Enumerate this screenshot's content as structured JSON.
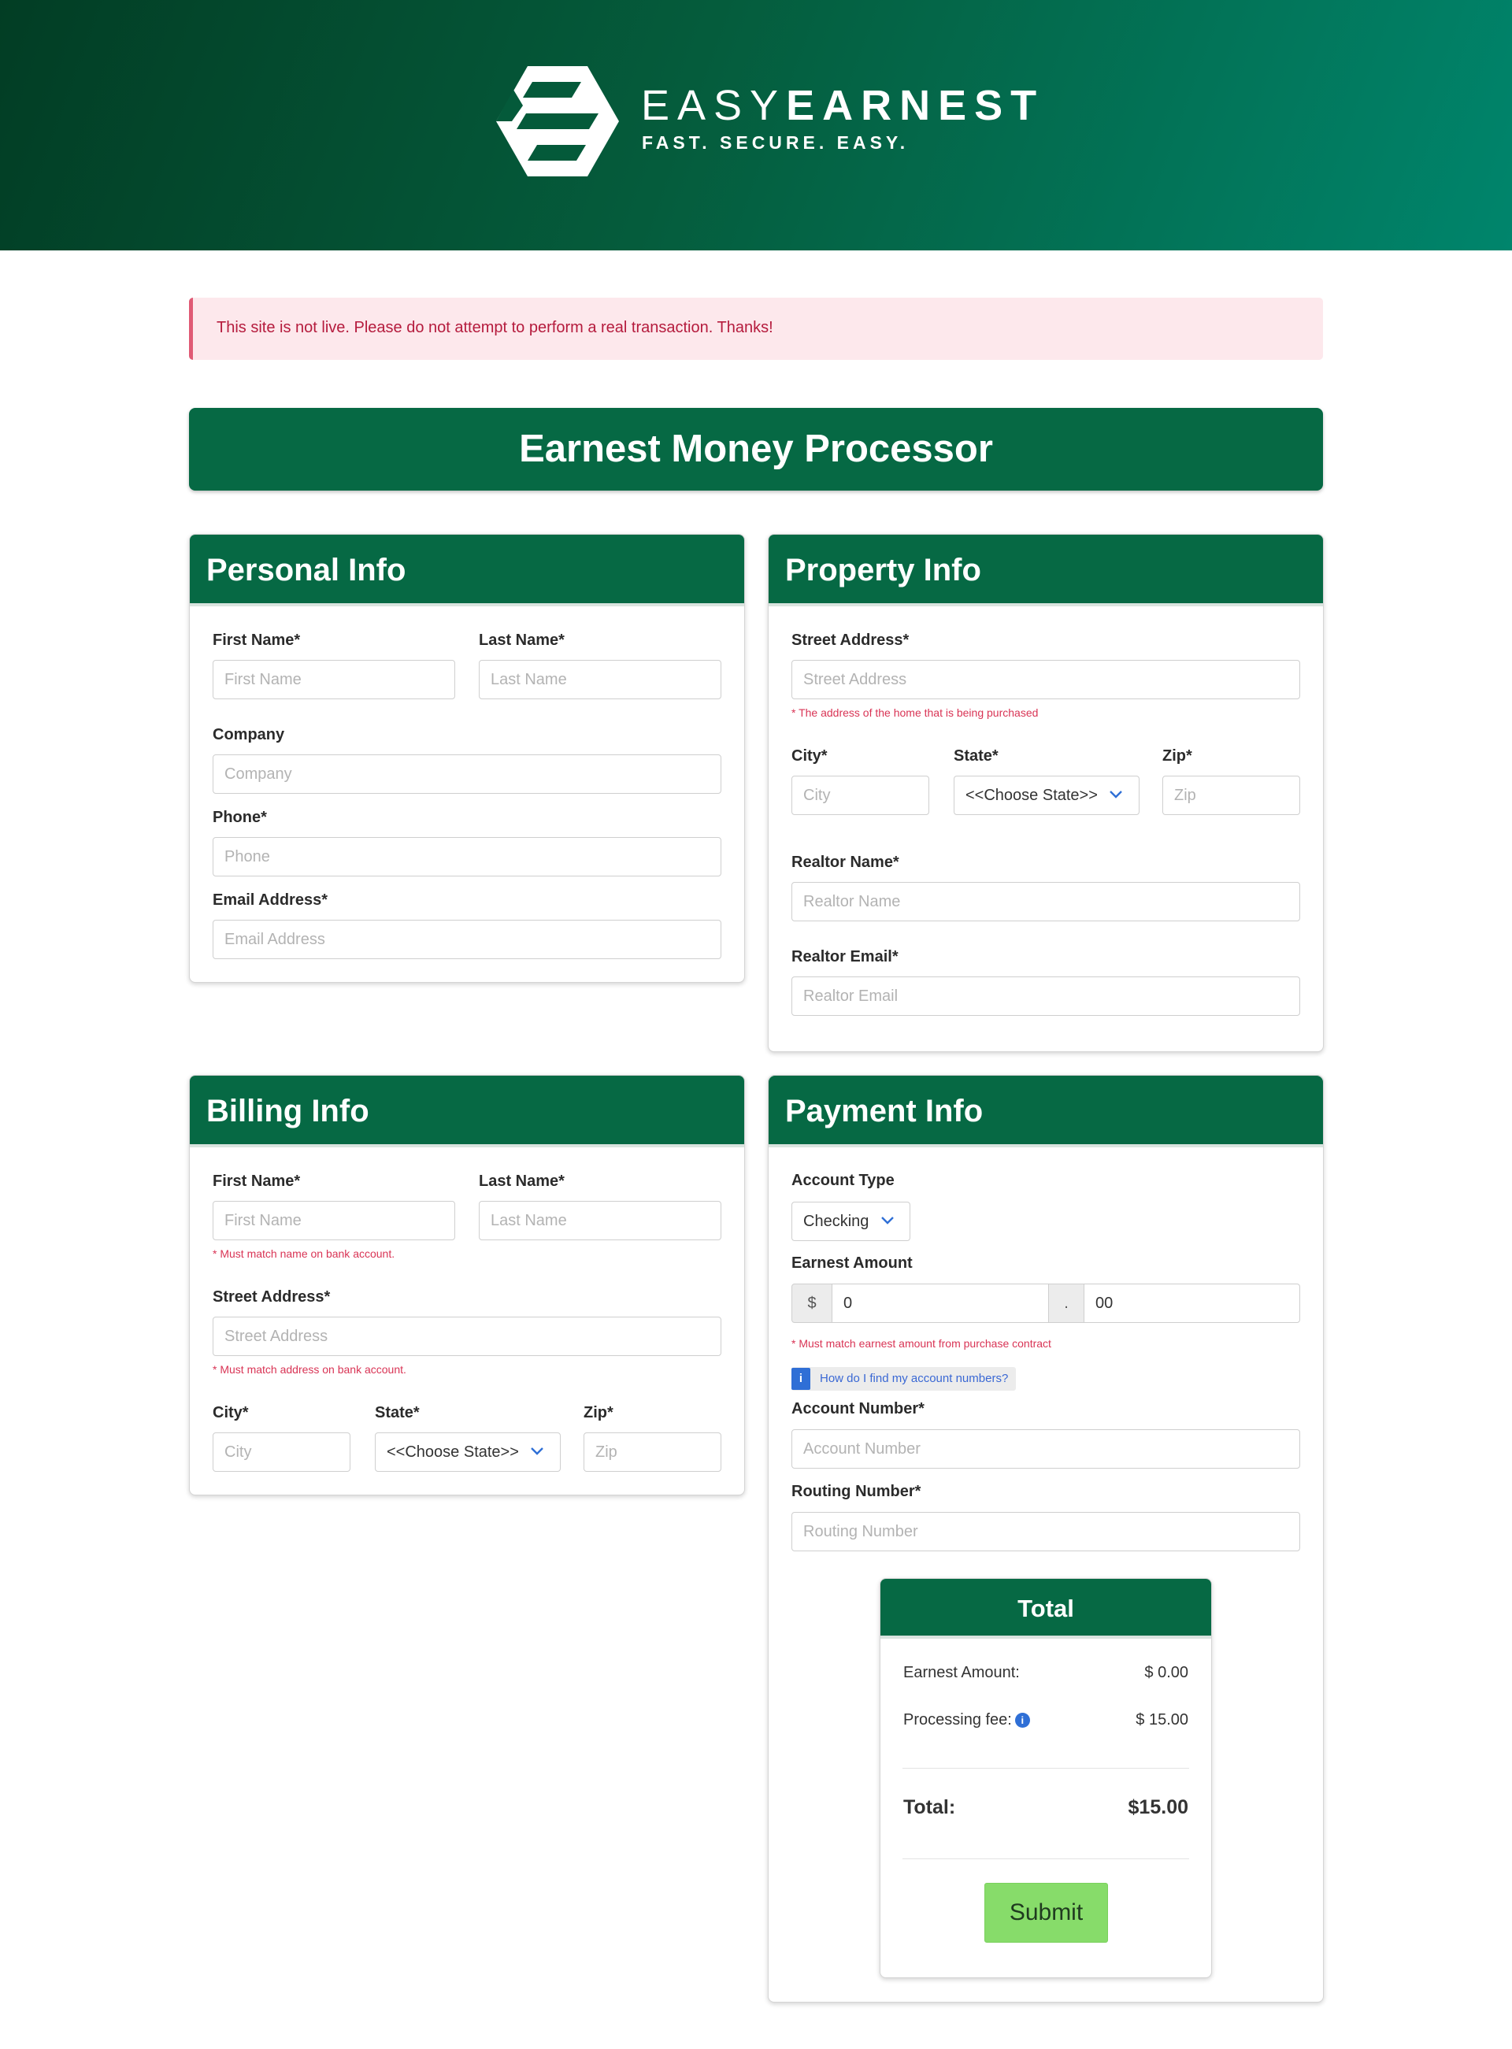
{
  "brand": {
    "name_light": "EASY",
    "name_bold": "EARNEST",
    "tagline": "FAST. SECURE. EASY.",
    "colors": {
      "header_dark": "#023d24",
      "header_light": "#00856c",
      "accent": "#066944",
      "submit": "#87dc6a",
      "alert_text": "#b51b3d"
    }
  },
  "notice": {
    "text": "This site is not live. Please do not attempt to perform a real transaction. Thanks!"
  },
  "page_title": "Earnest Money Processor",
  "personal": {
    "title": "Personal Info",
    "first_name_label": "First Name*",
    "first_name_placeholder": "First Name",
    "last_name_label": "Last Name*",
    "last_name_placeholder": "Last Name",
    "company_label": "Company",
    "company_placeholder": "Company",
    "phone_label": "Phone*",
    "phone_placeholder": "Phone",
    "email_label": "Email Address*",
    "email_placeholder": "Email Address"
  },
  "property": {
    "title": "Property Info",
    "street_label": "Street Address*",
    "street_placeholder": "Street Address",
    "street_hint": "* The address of the home that is being purchased",
    "city_label": "City*",
    "city_placeholder": "City",
    "state_label": "State*",
    "state_value": "<<Choose State>>",
    "zip_label": "Zip*",
    "zip_placeholder": "Zip",
    "realtor_name_label": "Realtor Name*",
    "realtor_name_placeholder": "Realtor Name",
    "realtor_email_label": "Realtor Email*",
    "realtor_email_placeholder": "Realtor Email"
  },
  "billing": {
    "title": "Billing Info",
    "first_name_label": "First Name*",
    "first_name_placeholder": "First Name",
    "last_name_label": "Last Name*",
    "last_name_placeholder": "Last Name",
    "name_hint": "* Must match name on bank account.",
    "street_label": "Street Address*",
    "street_placeholder": "Street Address",
    "street_hint": "* Must match address on bank account.",
    "city_label": "City*",
    "city_placeholder": "City",
    "state_label": "State*",
    "state_value": "<<Choose State>>",
    "zip_label": "Zip*",
    "zip_placeholder": "Zip"
  },
  "payment": {
    "title": "Payment Info",
    "account_type_label": "Account Type",
    "account_type_value": "Checking",
    "earnest_label": "Earnest Amount",
    "currency_symbol": "$",
    "amount_dollars": "0",
    "decimal_sep": ".",
    "amount_cents": "00",
    "earnest_hint": "* Must match earnest amount from purchase contract",
    "help_badge": "i",
    "help_text": "How do I find my account numbers?",
    "account_number_label": "Account Number*",
    "account_number_placeholder": "Account Number",
    "routing_number_label": "Routing Number*",
    "routing_number_placeholder": "Routing Number"
  },
  "total": {
    "title": "Total",
    "earnest_label": "Earnest Amount:",
    "earnest_value": "$ 0.00",
    "fee_label": "Processing fee:",
    "fee_info": "i",
    "fee_value": "$ 15.00",
    "total_label": "Total:",
    "total_value": "$15.00",
    "submit_label": "Submit"
  }
}
